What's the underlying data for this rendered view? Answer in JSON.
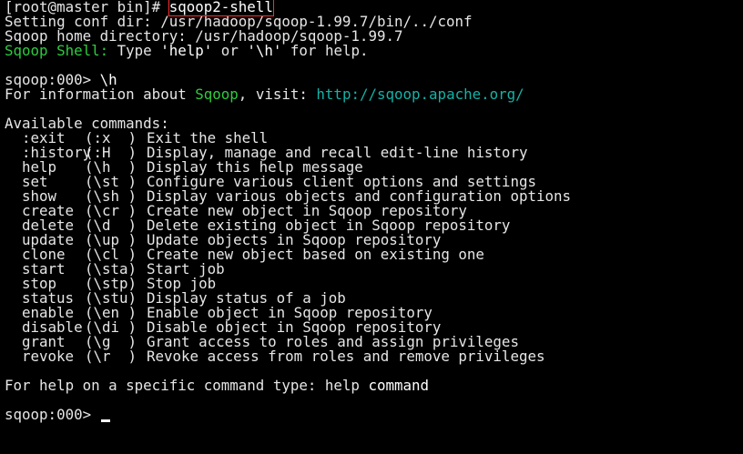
{
  "terminal": {
    "prompt_root": "[root@master bin]# ",
    "command": "sqoop2-shell",
    "setting_conf": "Setting conf dir: /usr/hadoop/sqoop-1.99.7/bin/../conf",
    "home_dir": "Sqoop home directory: /usr/hadoop/sqoop-1.99.7",
    "shell_label": "Sqoop Shell:",
    "shell_tail_1": " Type ",
    "shell_help": "'help'",
    "shell_tail_2": " or ",
    "shell_h": "'\\h'",
    "shell_tail_3": " for help.",
    "sqoop_prompt": "sqoop:000> ",
    "help_cmd": "\\h",
    "info_pre": "For information about ",
    "info_sqoop": "Sqoop",
    "info_mid": ", visit: ",
    "info_url": "http://sqoop.apache.org/",
    "available": "Available commands:",
    "commands": [
      {
        "name": ":exit",
        "alias": "(:x  )",
        "desc": "Exit the shell"
      },
      {
        "name": ":history",
        "alias": "(:H  )",
        "desc": "Display, manage and recall edit-line history"
      },
      {
        "name": "help",
        "alias": "(\\h  )",
        "desc": "Display this help message"
      },
      {
        "name": "set",
        "alias": "(\\st )",
        "desc": "Configure various client options and settings"
      },
      {
        "name": "show",
        "alias": "(\\sh )",
        "desc": "Display various objects and configuration options"
      },
      {
        "name": "create",
        "alias": "(\\cr )",
        "desc": "Create new object in Sqoop repository"
      },
      {
        "name": "delete",
        "alias": "(\\d  )",
        "desc": "Delete existing object in Sqoop repository"
      },
      {
        "name": "update",
        "alias": "(\\up )",
        "desc": "Update objects in Sqoop repository"
      },
      {
        "name": "clone",
        "alias": "(\\cl )",
        "desc": "Create new object based on existing one"
      },
      {
        "name": "start",
        "alias": "(\\sta)",
        "desc": "Start job"
      },
      {
        "name": "stop",
        "alias": "(\\stp)",
        "desc": "Stop job"
      },
      {
        "name": "status",
        "alias": "(\\stu)",
        "desc": "Display status of a job"
      },
      {
        "name": "enable",
        "alias": "(\\en )",
        "desc": "Enable object in Sqoop repository"
      },
      {
        "name": "disable",
        "alias": "(\\di )",
        "desc": "Disable object in Sqoop repository"
      },
      {
        "name": "grant",
        "alias": "(\\g  )",
        "desc": "Grant access to roles and assign privileges"
      },
      {
        "name": "revoke",
        "alias": "(\\r  )",
        "desc": "Revoke access from roles and remove privileges"
      }
    ],
    "help_specific_pre": "For help on a specific command type: help ",
    "help_specific_cmd": "command",
    "colors": {
      "background": "#000000",
      "text": "#e6e6e6",
      "green": "#2ecc40",
      "teal": "#14b3a8",
      "highlight_box": "#ff2b2b"
    }
  }
}
